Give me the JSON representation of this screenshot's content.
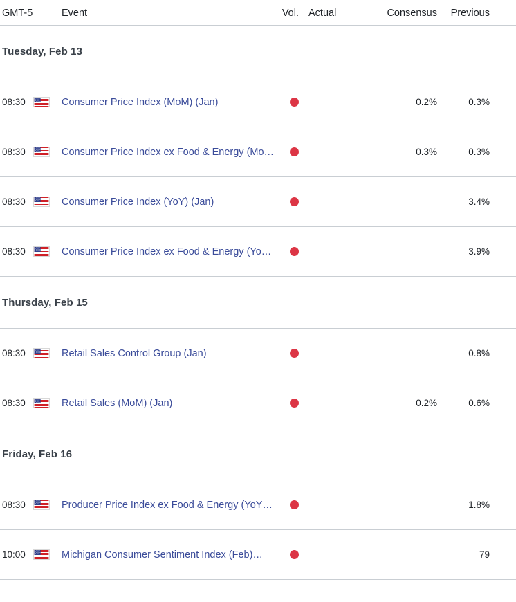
{
  "table": {
    "columns": {
      "time": "GMT-5",
      "event": "Event",
      "vol": "Vol.",
      "actual": "Actual",
      "consensus": "Consensus",
      "previous": "Previous"
    }
  },
  "colors": {
    "link": "#3b4c9a",
    "volatility_high": "#dc3545",
    "divider": "#c9ced3",
    "day_label": "#3a4149",
    "text": "#1f2328"
  },
  "icons": {
    "flag": "us-flag-icon",
    "volatility": "volatility-dot-icon"
  },
  "days": [
    {
      "label": "Tuesday, Feb 13",
      "events": [
        {
          "time": "08:30",
          "country": "United States",
          "flag": "us-flag-icon",
          "name": "Consumer Price Index (MoM) (Jan)",
          "volatility": "high",
          "actual": "",
          "consensus": "0.2%",
          "previous": "0.3%"
        },
        {
          "time": "08:30",
          "country": "United States",
          "flag": "us-flag-icon",
          "name": "Consumer Price Index ex Food & Energy (Mo…",
          "volatility": "high",
          "actual": "",
          "consensus": "0.3%",
          "previous": "0.3%"
        },
        {
          "time": "08:30",
          "country": "United States",
          "flag": "us-flag-icon",
          "name": "Consumer Price Index (YoY) (Jan)",
          "volatility": "high",
          "actual": "",
          "consensus": "",
          "previous": "3.4%"
        },
        {
          "time": "08:30",
          "country": "United States",
          "flag": "us-flag-icon",
          "name": "Consumer Price Index ex Food & Energy (Yo…",
          "volatility": "high",
          "actual": "",
          "consensus": "",
          "previous": "3.9%"
        }
      ]
    },
    {
      "label": "Thursday, Feb 15",
      "events": [
        {
          "time": "08:30",
          "country": "United States",
          "flag": "us-flag-icon",
          "name": "Retail Sales Control Group (Jan)",
          "volatility": "high",
          "actual": "",
          "consensus": "",
          "previous": "0.8%"
        },
        {
          "time": "08:30",
          "country": "United States",
          "flag": "us-flag-icon",
          "name": "Retail Sales (MoM) (Jan)",
          "volatility": "high",
          "actual": "",
          "consensus": "0.2%",
          "previous": "0.6%"
        }
      ]
    },
    {
      "label": "Friday, Feb 16",
      "events": [
        {
          "time": "08:30",
          "country": "United States",
          "flag": "us-flag-icon",
          "name": "Producer Price Index ex Food & Energy (YoY)…",
          "volatility": "high",
          "actual": "",
          "consensus": "",
          "previous": "1.8%"
        },
        {
          "time": "10:00",
          "country": "United States",
          "flag": "us-flag-icon",
          "name": "Michigan Consumer Sentiment Index (Feb)…",
          "volatility": "high",
          "actual": "",
          "consensus": "",
          "previous": "79"
        }
      ]
    }
  ]
}
